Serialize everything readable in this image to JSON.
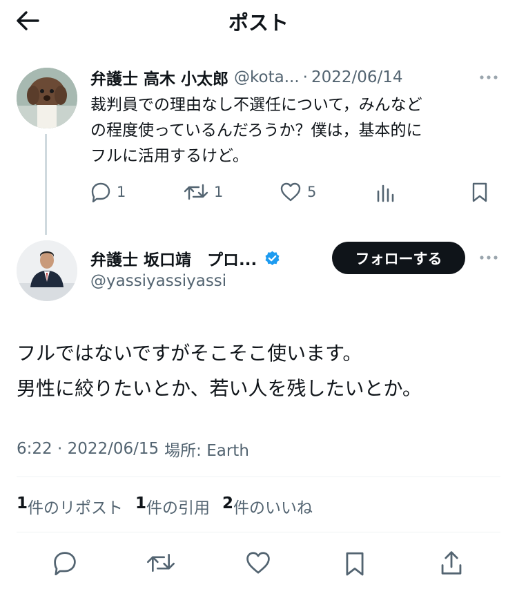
{
  "header": {
    "title": "ポスト",
    "back_icon": "arrow-left-icon"
  },
  "parent_post": {
    "author_name": "弁護士 高木 小太郎",
    "handle": "@kota...",
    "separator": "·",
    "date": "2022/06/14",
    "text_lines": [
      "裁判員での理由なし不選任について，みんなど",
      "の程度使っているんだろうか？僕は，基本的に",
      "フルに活用するけど。"
    ],
    "reply_count": "1",
    "repost_count": "1",
    "like_count": "5"
  },
  "main_post": {
    "author_name": "弁護士 坂口靖　プロ...",
    "verified": true,
    "handle": "@yassiyassiyassi",
    "follow_label": "フォローする",
    "text_lines": [
      "フルではないですがそこそこ使います。",
      "男性に絞りたいとか、若い人を残したいとか。"
    ],
    "timestamp": "6:22 · 2022/06/15",
    "location_label": "場所: Earth"
  },
  "stats": {
    "reposts_num": "1",
    "reposts_label": "件のリポスト",
    "quotes_num": "1",
    "quotes_label": "件の引用",
    "likes_num": "2",
    "likes_label": "件のいいね"
  },
  "colors": {
    "text": "#0f1419",
    "gray": "#536471",
    "verified": "#1d9bf0",
    "divider": "#eff3f4",
    "thread": "#cfd9de"
  }
}
